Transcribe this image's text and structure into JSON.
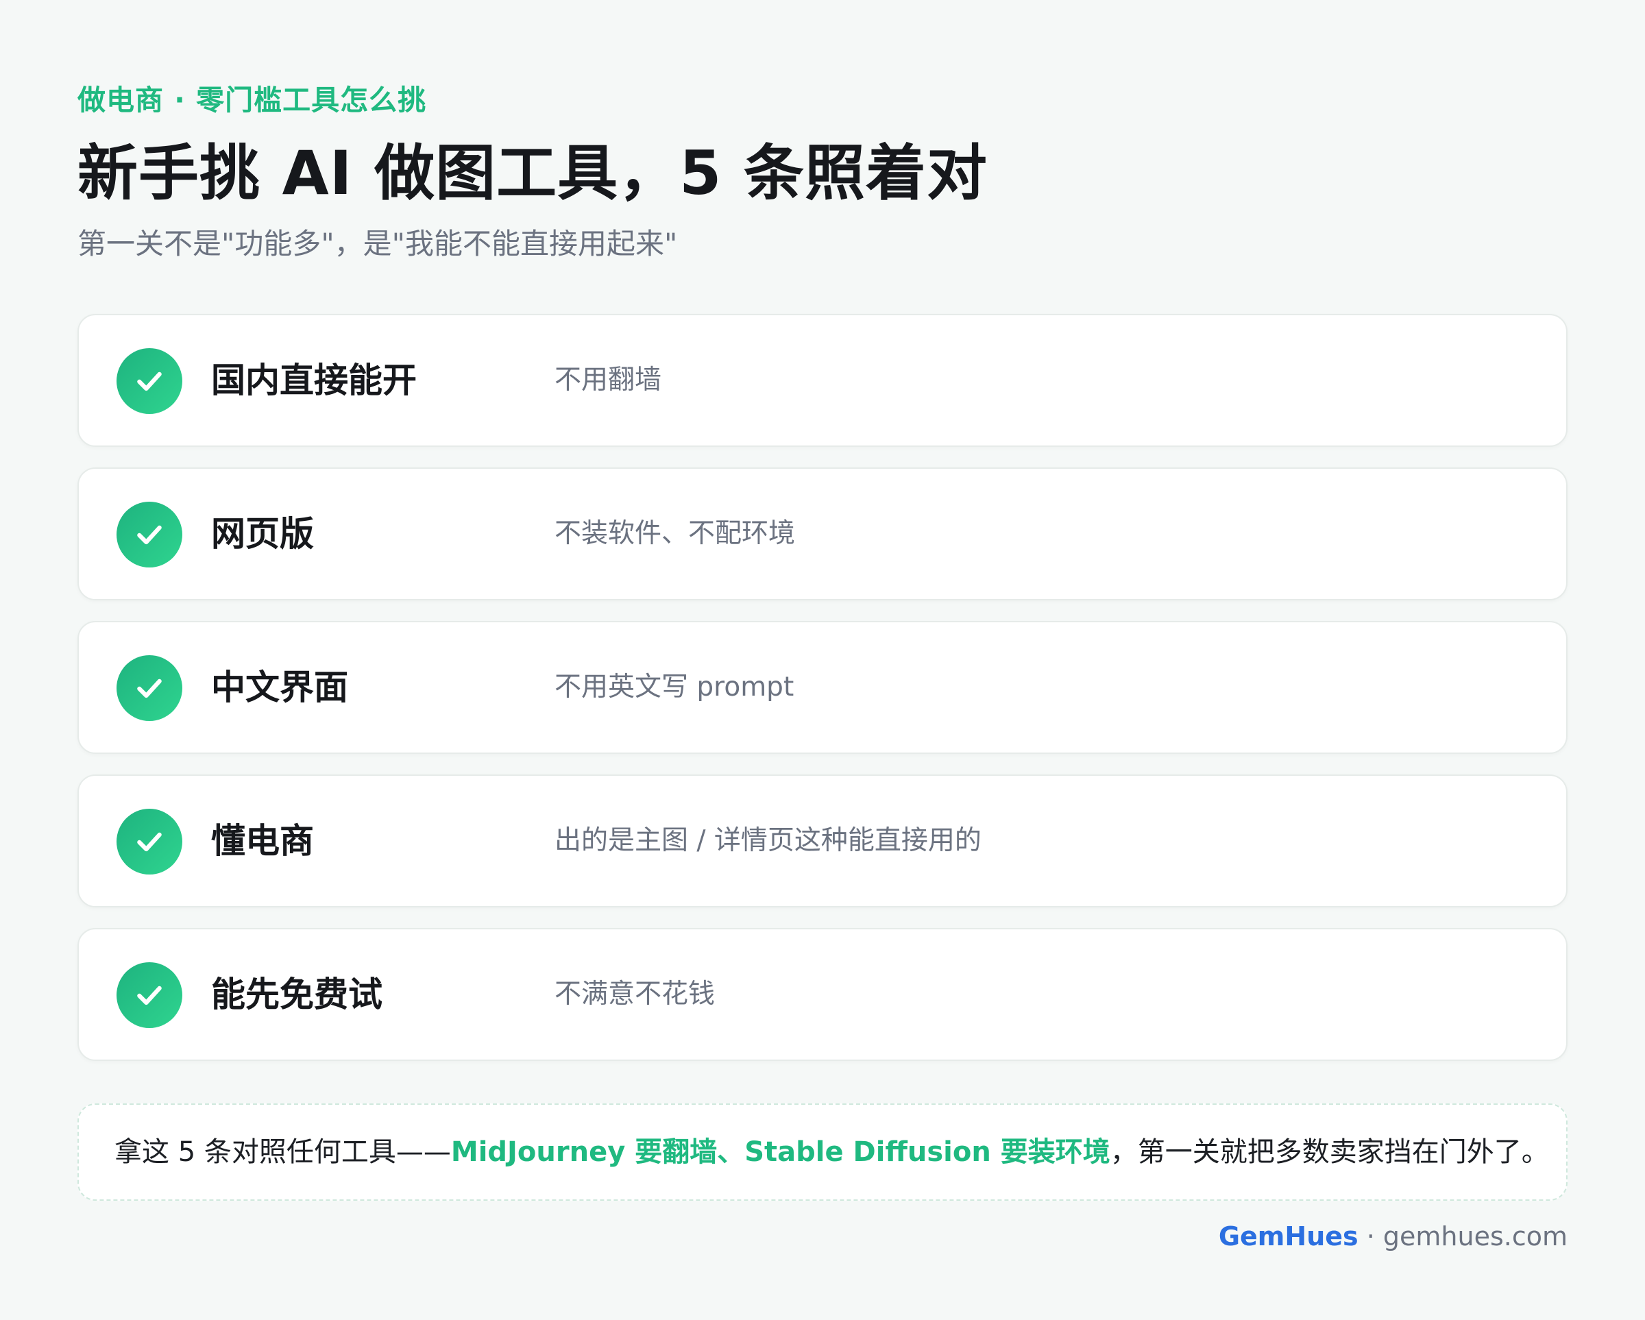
{
  "header": {
    "eyebrow": "做电商 · 零门槛工具怎么挑",
    "title": "新手挑 AI 做图工具，5 条照着对",
    "subtitle": "第一关不是\"功能多\"，是\"我能不能直接用起来\""
  },
  "checklist": [
    {
      "label": "国内直接能开",
      "desc": "不用翻墙",
      "icon": "check-icon"
    },
    {
      "label": "网页版",
      "desc": "不装软件、不配环境",
      "icon": "check-icon"
    },
    {
      "label": "中文界面",
      "desc": "不用英文写 prompt",
      "icon": "check-icon"
    },
    {
      "label": "懂电商",
      "desc": "出的是主图 / 详情页这种能直接用的",
      "icon": "check-icon"
    },
    {
      "label": "能先免费试",
      "desc": "不满意不花钱",
      "icon": "check-icon"
    }
  ],
  "note": {
    "prefix": "拿这 5 条对照任何工具——",
    "highlight": "MidJourney 要翻墙、Stable Diffusion 要装环境",
    "suffix": "，第一关就把多数卖家挡在门外了。"
  },
  "footer": {
    "brand": "GemHues",
    "separator": " · ",
    "domain": "gemhues.com"
  },
  "colors": {
    "accent": "#1fb980",
    "brand": "#2b6fe0",
    "background": "#f5f8f7",
    "muted": "#6b7280"
  }
}
